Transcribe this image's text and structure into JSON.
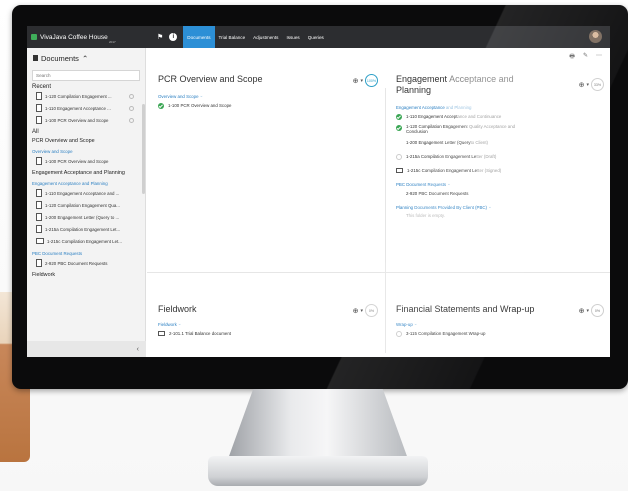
{
  "topbar": {
    "org_name": "VivaJava Coffee House",
    "org_sub": "2017",
    "tabs": [
      {
        "label": "Documents",
        "active": true
      },
      {
        "label": "Trial Balance",
        "active": false
      },
      {
        "label": "Adjustments",
        "active": false
      },
      {
        "label": "Issues",
        "active": false
      },
      {
        "label": "Queries",
        "active": false
      }
    ]
  },
  "sidebar": {
    "title": "Documents",
    "search_placeholder": "Search",
    "recent_label": "Recent",
    "recent": [
      "1-120 Compilation Engagement ...",
      "1-110 Engagement Acceptance ...",
      "1-100 PCR Overview and Scope"
    ],
    "all_label": "All",
    "pcr_group": "PCR Overview and Scope",
    "pcr_link": "Overview and Scope",
    "pcr_items": [
      "1-100 PCR Overview and Scope"
    ],
    "eng_group": "Engagement Acceptance and Planning",
    "eng_link": "Engagement Acceptance and Planning",
    "eng_items": [
      "1-110 Engagement Acceptance and ...",
      "1-120 Compilation Engagement Qua...",
      "1-200 Engagement Letter (Query to ...",
      "1-215a Compilation Engagement Let...",
      "1-215c Compilation Engagement Let..."
    ],
    "pbc_link": "PBC Document Requests",
    "pbc_items": [
      "2-920 PBC Document Requests"
    ],
    "fieldwork_group": "Fieldwork",
    "collapse": "‹"
  },
  "main": {
    "tools": [
      "🖶",
      "✎",
      "⋯"
    ],
    "pcr": {
      "title": "PCR Overview and Scope",
      "pct": "100%",
      "section": "Overview and Scope",
      "items": [
        "1-100 PCR Overview and Scope"
      ]
    },
    "engagement": {
      "title_a": "Engagement",
      "title_b": "Acceptance and",
      "title_c": "Planning",
      "pct": "33%",
      "section_a": "Engagement Acceptance",
      "section_b": "and Planning",
      "item1_a": "1-110 Engagement Accept",
      "item1_b": "ance and Continuance",
      "item2_a": "1-120 Compilation Engagemen",
      "item2_b": "t Quality Acceptance and",
      "item2_c": "Conclusion",
      "item3_a": "1-200 Engagement Letter (Query ",
      "item3_b": "to Client)",
      "item4_a": "1-215a Compilation Engagement Le",
      "item4_b": "tter (Draft)",
      "item5_a": "1-215c Compilation Engagement Le",
      "item5_b": "tter (Signed)",
      "pbc_section": "PBC Document Requests",
      "pbc_item": "2-920 PBC Document Requests",
      "planning_section": "Planning Documents Provided By Client (PBC)",
      "empty_note": "This folder is empty."
    },
    "fieldwork": {
      "title": "Fieldwork",
      "pct": "0%",
      "section": "Fieldwork",
      "items": [
        "2-101.1 Trial Balance document"
      ]
    },
    "financial": {
      "title": "Financial Statements and Wrap-up",
      "pct": "0%",
      "section": "Wrap-up",
      "items": [
        "3-115 Compilation Engagement Wrap-up"
      ]
    }
  }
}
